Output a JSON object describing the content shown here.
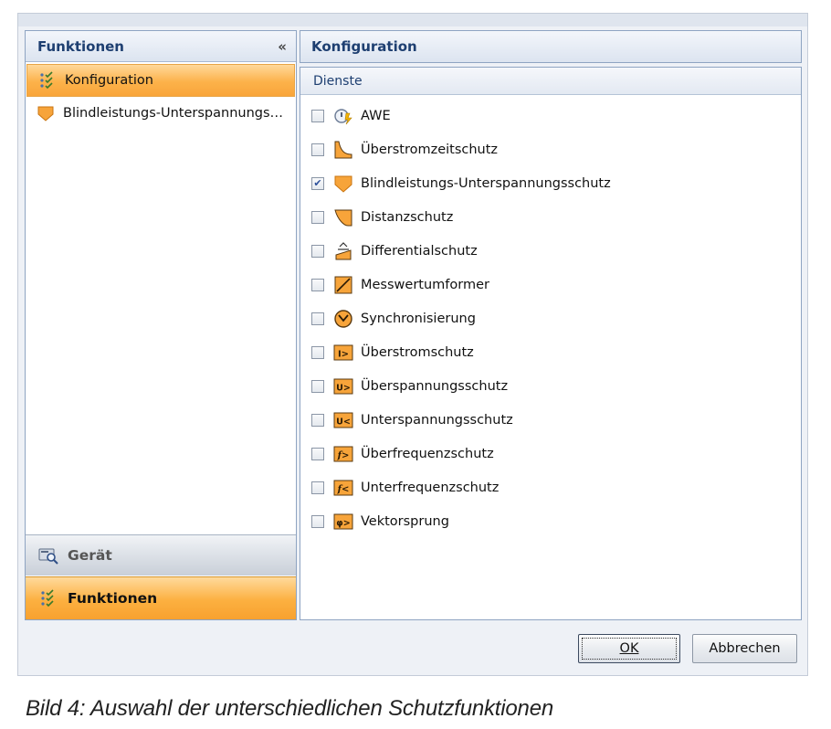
{
  "left_pane": {
    "header": "Funktionen",
    "collapse_glyph": "«",
    "items": [
      {
        "label": "Konfiguration",
        "icon": "checklist-icon",
        "selected": true
      },
      {
        "label": "Blindleistungs-Unterspannungs…",
        "icon": "shield-icon",
        "selected": false
      }
    ],
    "bottom_buttons": [
      {
        "label": "Gerät",
        "icon": "device-search-icon"
      },
      {
        "label": "Funktionen",
        "icon": "checklist-icon",
        "active": true
      }
    ]
  },
  "right_pane": {
    "header": "Konfiguration",
    "section": "Dienste",
    "services": [
      {
        "label": "AWE",
        "checked": false,
        "icon": "awe-icon"
      },
      {
        "label": "Überstromzeitschutz",
        "checked": false,
        "icon": "time-curve-icon"
      },
      {
        "label": "Blindleistungs-Unterspannungsschutz",
        "checked": true,
        "icon": "shield-icon"
      },
      {
        "label": "Distanzschutz",
        "checked": false,
        "icon": "distance-icon"
      },
      {
        "label": "Differentialschutz",
        "checked": false,
        "icon": "differential-icon"
      },
      {
        "label": "Messwertumformer",
        "checked": false,
        "icon": "transducer-icon"
      },
      {
        "label": "Synchronisierung",
        "checked": false,
        "icon": "sync-clock-icon"
      },
      {
        "label": "Überstromschutz",
        "checked": false,
        "icon": "i-greater-icon",
        "glyph": "I>"
      },
      {
        "label": "Überspannungsschutz",
        "checked": false,
        "icon": "u-greater-icon",
        "glyph": "U>"
      },
      {
        "label": "Unterspannungsschutz",
        "checked": false,
        "icon": "u-less-icon",
        "glyph": "U<"
      },
      {
        "label": "Überfrequenzschutz",
        "checked": false,
        "icon": "f-greater-icon",
        "glyph": "f>"
      },
      {
        "label": "Unterfrequenzschutz",
        "checked": false,
        "icon": "f-less-icon",
        "glyph": "f<"
      },
      {
        "label": "Vektorsprung",
        "checked": false,
        "icon": "phi-greater-icon",
        "glyph": "φ>"
      }
    ]
  },
  "buttons": {
    "ok": "OK",
    "cancel": "Abbrechen"
  },
  "caption": "Bild 4: Auswahl der unterschiedlichen Schutzfunktionen",
  "colors": {
    "accent_orange": "#fcb24a",
    "header_blue": "#1e3f71",
    "border": "#8ea4c2"
  }
}
